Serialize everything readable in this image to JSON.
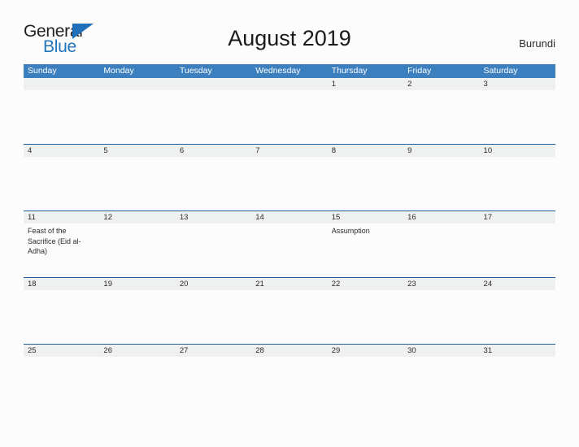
{
  "brand": {
    "name_part1": "General",
    "name_part2": "Blue",
    "flag_icon": "blue-flag-triangle-icon"
  },
  "header": {
    "title": "August 2019",
    "country": "Burundi"
  },
  "colors": {
    "header_blue": "#3b7fbf",
    "row_rule_blue": "#1f5f9e",
    "band_gray": "#eff0f0",
    "brand_blue": "#2175bb",
    "page_background": "#fcfcfd",
    "text_dark": "#2b2b2b"
  },
  "calendar": {
    "month": "August",
    "year": "2019",
    "day_headers": [
      "Sunday",
      "Monday",
      "Tuesday",
      "Wednesday",
      "Thursday",
      "Friday",
      "Saturday"
    ],
    "weeks": [
      [
        {
          "date": "",
          "events": []
        },
        {
          "date": "",
          "events": []
        },
        {
          "date": "",
          "events": []
        },
        {
          "date": "",
          "events": []
        },
        {
          "date": "1",
          "events": []
        },
        {
          "date": "2",
          "events": []
        },
        {
          "date": "3",
          "events": []
        }
      ],
      [
        {
          "date": "4",
          "events": []
        },
        {
          "date": "5",
          "events": []
        },
        {
          "date": "6",
          "events": []
        },
        {
          "date": "7",
          "events": []
        },
        {
          "date": "8",
          "events": []
        },
        {
          "date": "9",
          "events": []
        },
        {
          "date": "10",
          "events": []
        }
      ],
      [
        {
          "date": "11",
          "events": [
            "Feast of the Sacrifice (Eid al-Adha)"
          ]
        },
        {
          "date": "12",
          "events": []
        },
        {
          "date": "13",
          "events": []
        },
        {
          "date": "14",
          "events": []
        },
        {
          "date": "15",
          "events": [
            "Assumption"
          ]
        },
        {
          "date": "16",
          "events": []
        },
        {
          "date": "17",
          "events": []
        }
      ],
      [
        {
          "date": "18",
          "events": []
        },
        {
          "date": "19",
          "events": []
        },
        {
          "date": "20",
          "events": []
        },
        {
          "date": "21",
          "events": []
        },
        {
          "date": "22",
          "events": []
        },
        {
          "date": "23",
          "events": []
        },
        {
          "date": "24",
          "events": []
        }
      ],
      [
        {
          "date": "25",
          "events": []
        },
        {
          "date": "26",
          "events": []
        },
        {
          "date": "27",
          "events": []
        },
        {
          "date": "28",
          "events": []
        },
        {
          "date": "29",
          "events": []
        },
        {
          "date": "30",
          "events": []
        },
        {
          "date": "31",
          "events": []
        }
      ]
    ]
  }
}
